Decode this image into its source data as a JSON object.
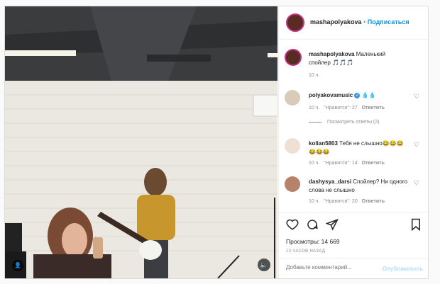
{
  "post": {
    "username": "mashapolyakova",
    "dot": "•",
    "follow_label": "Подписаться",
    "caption_user": "mashapolyakova",
    "caption_text": "Маленький спойлер 🎵🎵🎵",
    "caption_time": "10 ч."
  },
  "comments": [
    {
      "user": "polyakovamusic",
      "text": "💧💧",
      "time": "10 ч.",
      "likes": "\"Нравится\": 27",
      "reply": "Ответить",
      "view_replies": "Посмотреть ответы (2)"
    },
    {
      "user": "kolian5803",
      "text": "Тебя не слышно😂😂😂😂😂😂",
      "time": "10 ч.",
      "likes": "\"Нравится\": 14",
      "reply": "Ответить"
    },
    {
      "user": "dashysya_darsi",
      "text": "Спойлер? Ни одного слова не слышно",
      "time": "10 ч.",
      "likes": "\"Нравится\": 20",
      "reply": "Ответить"
    }
  ],
  "stats": {
    "views": "Просмотры: 14 669",
    "timestamp": "10 ЧАСОВ НАЗАД"
  },
  "add_comment": {
    "placeholder": "Добавьте комментарий...",
    "publish": "Опубликовать"
  },
  "media": {
    "volume_icon": "volume-icon",
    "user_icon": "user-tag-icon"
  },
  "colors": {
    "accent": "#0095f6",
    "muted": "#8e8e8e",
    "verified": "#3897f0"
  }
}
